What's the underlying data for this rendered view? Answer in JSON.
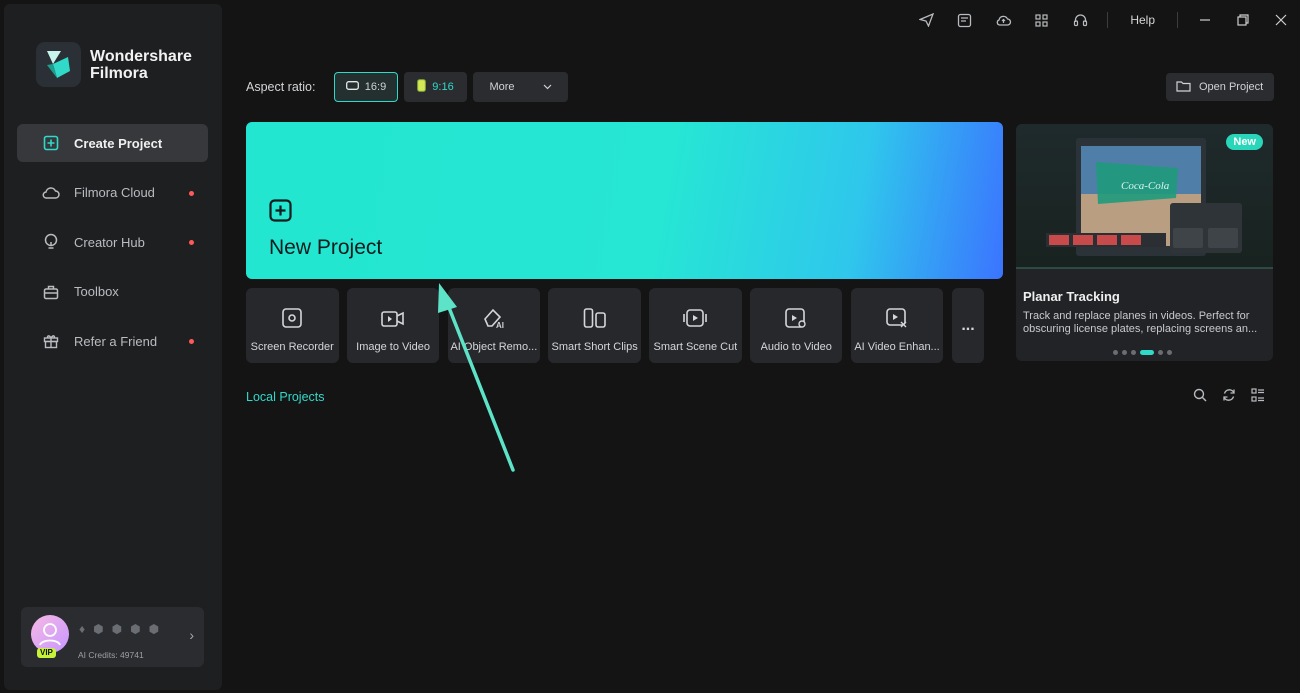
{
  "app": {
    "name_line1": "Wondershare",
    "name_line2": "Filmora"
  },
  "sidebar": {
    "items": [
      {
        "label": "Create Project",
        "icon": "plus-square-icon",
        "active": true,
        "dot": false
      },
      {
        "label": "Filmora Cloud",
        "icon": "cloud-icon",
        "active": false,
        "dot": true
      },
      {
        "label": "Creator Hub",
        "icon": "bulb-icon",
        "active": false,
        "dot": true
      },
      {
        "label": "Toolbox",
        "icon": "toolbox-icon",
        "active": false,
        "dot": false
      },
      {
        "label": "Refer a Friend",
        "icon": "gift-icon",
        "active": false,
        "dot": true
      }
    ]
  },
  "account": {
    "vip_label": "VIP",
    "credits": "AI Credits: 49741"
  },
  "topbar": {
    "help": "Help"
  },
  "aspect": {
    "label": "Aspect ratio:",
    "options": [
      "16:9",
      "9:16"
    ],
    "more": "More"
  },
  "open_project": "Open Project",
  "new_project": {
    "title": "New Project"
  },
  "tools": [
    {
      "label": "Screen Recorder",
      "icon": "screen-recorder-icon"
    },
    {
      "label": "Image to Video",
      "icon": "image-to-video-icon"
    },
    {
      "label": "AI Object Remo...",
      "icon": "eraser-ai-icon"
    },
    {
      "label": "Smart Short Clips",
      "icon": "short-clips-icon"
    },
    {
      "label": "Smart Scene Cut",
      "icon": "scene-cut-icon"
    },
    {
      "label": "Audio to Video",
      "icon": "audio-to-video-icon"
    },
    {
      "label": "AI Video Enhan...",
      "icon": "video-enhance-icon"
    }
  ],
  "tools_more": "...",
  "promo": {
    "tag": "New",
    "title": "Planar Tracking",
    "description": "Track and replace planes in videos. Perfect for obscuring license plates, replacing screens an...",
    "dot_count": 6,
    "active_dot": 3
  },
  "local_projects": {
    "title": "Local Projects"
  },
  "colors": {
    "accent": "#31d9c8",
    "sidebar_bg": "#1e1f21",
    "main_bg": "#141414"
  }
}
